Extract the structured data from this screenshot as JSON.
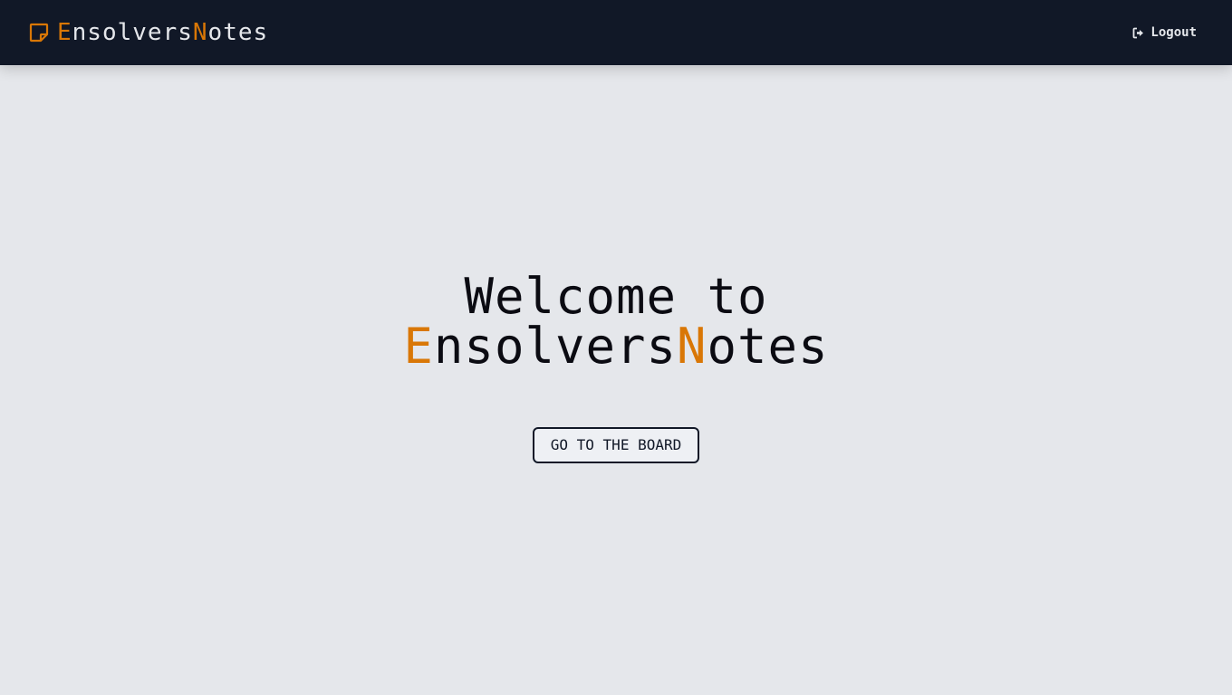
{
  "header": {
    "brand": {
      "icon": "sticky-note-icon",
      "accent_1": "E",
      "part_1": "nsolvers",
      "accent_2": "N",
      "part_2": "otes"
    },
    "logout": {
      "icon": "sign-out-icon",
      "label": "Logout"
    }
  },
  "hero": {
    "line_1": "Welcome to",
    "brand": {
      "accent_1": "E",
      "part_1": "nsolvers",
      "accent_2": "N",
      "part_2": "otes"
    },
    "button_label": "GO TO THE BOARD"
  },
  "colors": {
    "navbar_bg": "#111827",
    "page_bg": "#e5e7eb",
    "accent": "#d97706",
    "text_dark": "#0b0b12"
  }
}
